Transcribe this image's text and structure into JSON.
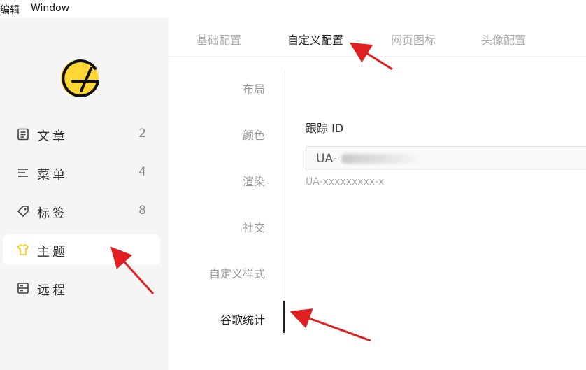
{
  "menubar": {
    "edit": "编辑",
    "window": "Window"
  },
  "sidebar": {
    "items": [
      {
        "label": "文章",
        "count": "2",
        "icon": "document-icon"
      },
      {
        "label": "菜单",
        "count": "4",
        "icon": "menu-icon"
      },
      {
        "label": "标签",
        "count": "8",
        "icon": "tag-icon"
      },
      {
        "label": "主题",
        "count": "",
        "icon": "shirt-icon",
        "active": true
      },
      {
        "label": "远程",
        "count": "",
        "icon": "server-icon"
      }
    ],
    "logo_color": "#ffd633"
  },
  "tabs": [
    "基础配置",
    "自定义配置",
    "网页图标",
    "头像配置"
  ],
  "active_tab": "自定义配置",
  "subnav": [
    "布局",
    "颜色",
    "渲染",
    "社交",
    "自定义样式",
    "谷歌统计"
  ],
  "active_subnav": "谷歌统计",
  "form": {
    "label": "跟踪 ID",
    "value": "UA-",
    "hint": "UA-xxxxxxxxx-x"
  },
  "colors": {
    "arrow": "#e02020",
    "sidebar_bg": "#f5f5f5",
    "icon_accent": "#f5c518"
  }
}
